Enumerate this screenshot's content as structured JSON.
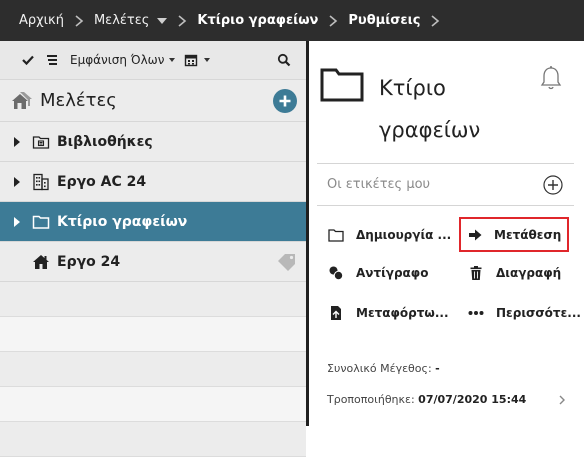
{
  "breadcrumb": {
    "items": [
      {
        "label": "Αρχική",
        "bold": false
      },
      {
        "label": "Μελέτες",
        "bold": false,
        "dropdown": true
      },
      {
        "label": "Κτίριο γραφείων",
        "bold": true
      },
      {
        "label": "Ρυθμίσεις",
        "bold": true
      }
    ]
  },
  "left_toolbar": {
    "filter_label": "Εμφάνιση Όλων",
    "icons": [
      "checkmark-icon",
      "list-icon",
      "calendar-icon",
      "search-icon"
    ]
  },
  "projects": {
    "title": "Μελέτες",
    "items": [
      {
        "label": "Βιβλιοθήκες",
        "icon": "library-icon",
        "expandable": true,
        "selected": false
      },
      {
        "label": "Εργο AC 24",
        "icon": "building-icon",
        "expandable": true,
        "selected": false
      },
      {
        "label": "Κτίριο γραφείων",
        "icon": "folder-icon",
        "expandable": true,
        "selected": true
      },
      {
        "label": "Εργο 24",
        "icon": "house-icon",
        "expandable": false,
        "selected": false,
        "tagged": true
      }
    ]
  },
  "details": {
    "title": "Κτίριο γραφείων",
    "tags_placeholder": "Οι ετικέτες μου",
    "actions": {
      "create": "Δημιουργία ...",
      "move": "Μετάθεση",
      "copy": "Αντίγραφο",
      "delete": "Διαγραφή",
      "upload": "Μεταφόρτω...",
      "more": "Περισσότε..."
    },
    "size_label": "Συνολικό Μέγεθος:",
    "size_value": "-",
    "modified_label": "Τροποποιήθηκε:",
    "modified_value": "07/07/2020 15:44"
  },
  "colors": {
    "topbar": "#2d2d2d",
    "accent": "#3d7b96",
    "highlight_border": "#e0262b"
  }
}
